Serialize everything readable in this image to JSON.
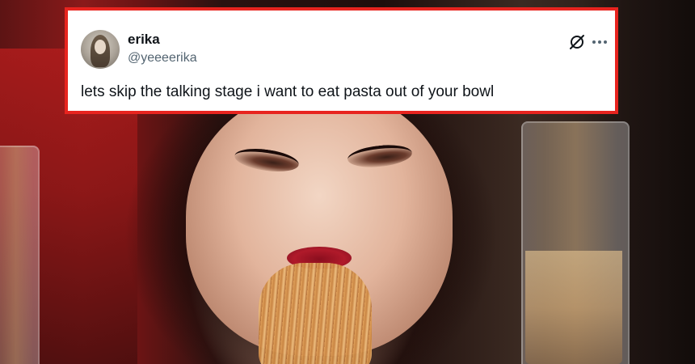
{
  "tweet": {
    "display_name": "erika",
    "handle": "@yeeeerika",
    "text": "lets skip the talking stage i want to eat pasta out of your bowl",
    "border_color": "#e8241f"
  },
  "icons": {
    "avatar": "user-avatar",
    "menu": "mute-icon",
    "more": "more-dots-icon"
  }
}
